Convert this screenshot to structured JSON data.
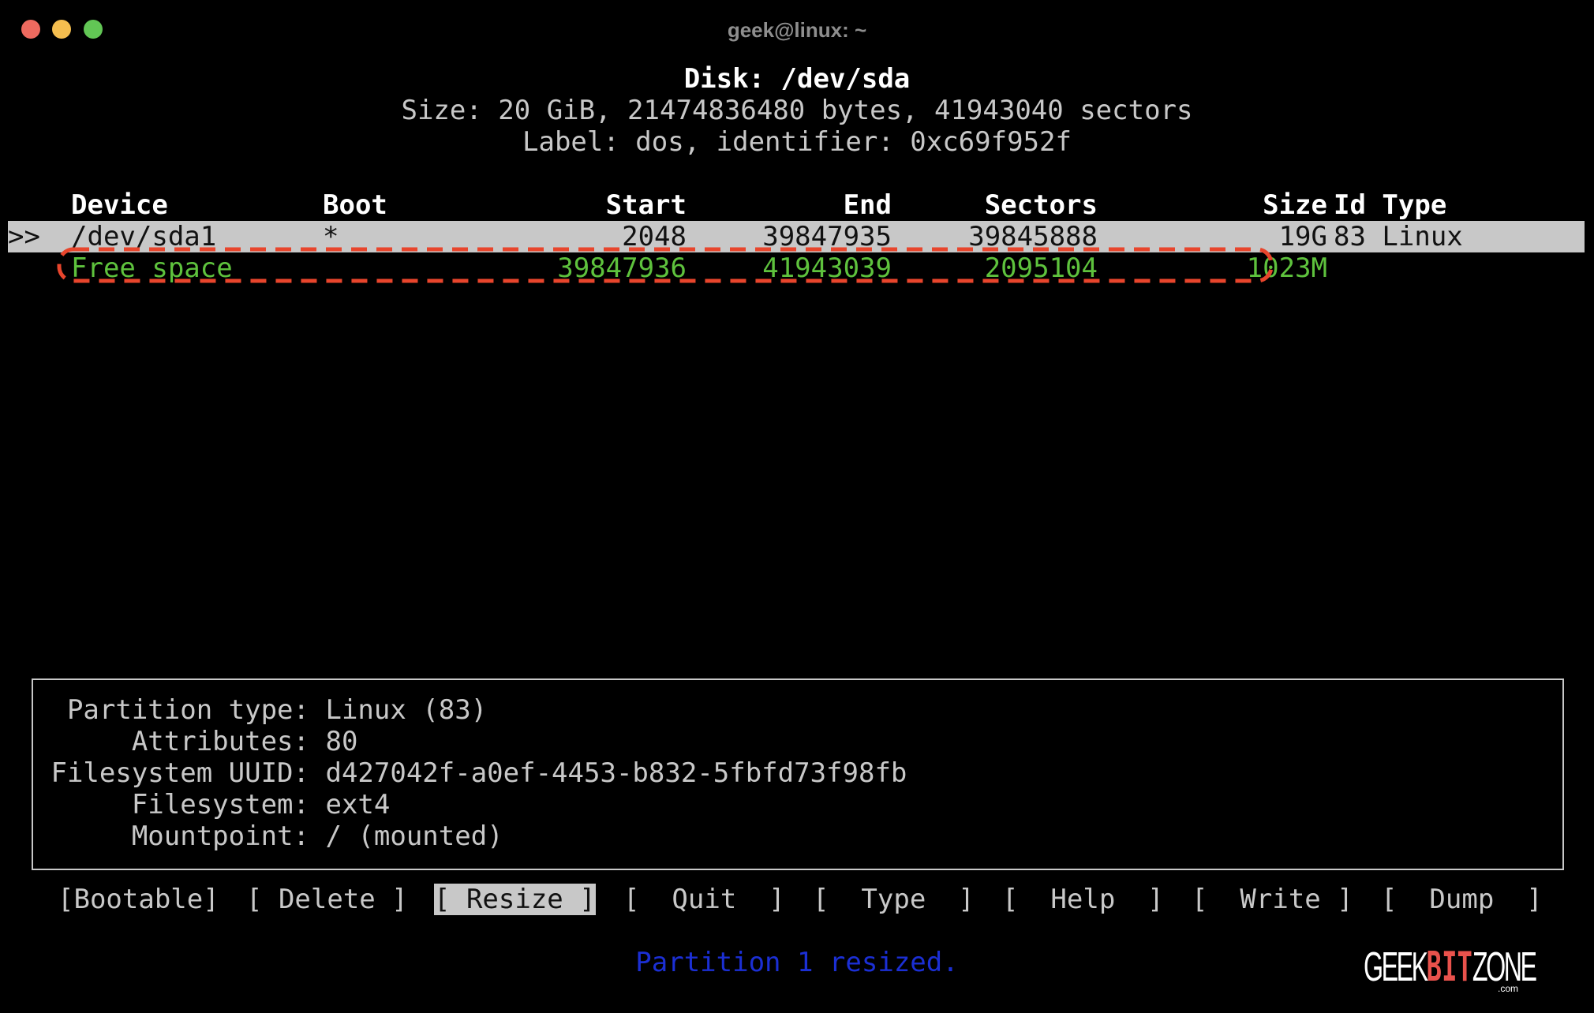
{
  "window": {
    "title": "geek@linux: ~",
    "controls": [
      "close",
      "minimize",
      "maximize"
    ]
  },
  "disk": {
    "title": "Disk: /dev/sda",
    "size_line": "Size: 20 GiB, 21474836480 bytes, 41943040 sectors",
    "label_line": "Label: dos, identifier: 0xc69f952f"
  },
  "table": {
    "headers": {
      "device": "Device",
      "boot": "Boot",
      "start": "Start",
      "end": "End",
      "sectors": "Sectors",
      "size": "Size",
      "id_type": "Id Type"
    },
    "rows": [
      {
        "pointer": ">>",
        "device": "/dev/sda1",
        "boot": "*",
        "start": "2048",
        "end": "39847935",
        "sectors": "39845888",
        "size": "19G",
        "id_type": "83 Linux",
        "selected": true
      },
      {
        "pointer": "",
        "device": "Free space",
        "boot": "",
        "start": "39847936",
        "end": "41943039",
        "sectors": "2095104",
        "size": "1023M",
        "id_type": "",
        "selected": false
      }
    ]
  },
  "info": [
    {
      "key": "Partition type:",
      "value": "Linux (83)"
    },
    {
      "key": "Attributes:",
      "value": "80"
    },
    {
      "key": "Filesystem UUID:",
      "value": "d427042f-a0ef-4453-b832-5fbfd73f98fb"
    },
    {
      "key": "Filesystem:",
      "value": "ext4"
    },
    {
      "key": "Mountpoint:",
      "value": "/ (mounted)"
    }
  ],
  "menu": [
    {
      "label": "[Bootable]",
      "active": false
    },
    {
      "label": "[ Delete ]",
      "active": false
    },
    {
      "label": "[ Resize ]",
      "active": true
    },
    {
      "label": "[  Quit  ]",
      "active": false
    },
    {
      "label": "[  Type  ]",
      "active": false
    },
    {
      "label": "[  Help  ]",
      "active": false
    },
    {
      "label": "[  Write ]",
      "active": false
    },
    {
      "label": "[  Dump  ]",
      "active": false
    }
  ],
  "status_message": "Partition 1 resized.",
  "watermark": {
    "part1": "GEEK",
    "part2": "BIT",
    "part3": "ZONE",
    "suffix": ".com"
  },
  "colors": {
    "free_space": "#5ec23d",
    "selection_bg": "#c8c8c8",
    "status_text": "#1b2fd4",
    "annotation": "#e8452c",
    "logo_accent": "#e9524c"
  }
}
